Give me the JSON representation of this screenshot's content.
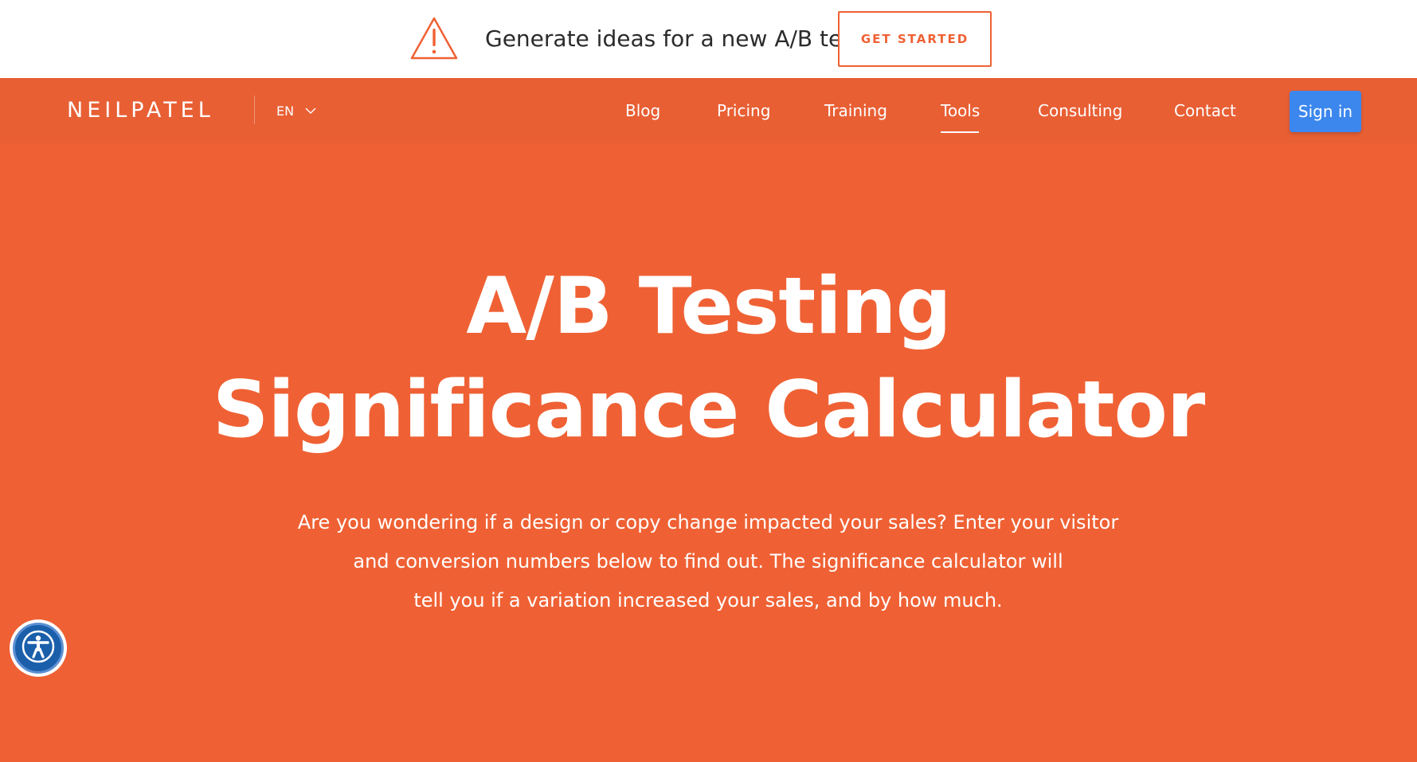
{
  "promo": {
    "text": "Generate ideas for a new A/B test",
    "button_label": "GET STARTED",
    "icon": "warning-triangle-icon",
    "accent_color": "#ef6134"
  },
  "nav": {
    "logo": "NEILPATEL",
    "language": "EN",
    "links": [
      {
        "label": "Blog"
      },
      {
        "label": "Pricing"
      },
      {
        "label": "Training"
      },
      {
        "label": "Tools",
        "active": true
      },
      {
        "label": "Consulting"
      },
      {
        "label": "Contact"
      }
    ],
    "signin_label": "Sign in",
    "signin_color": "#3c87ee"
  },
  "hero": {
    "background_color": "#ef6134",
    "title_lines": [
      "A/B Testing",
      "Significance Calculator"
    ],
    "subtitle_lines": [
      "Are you wondering if a design or copy change impacted your sales? Enter your visitor",
      "and conversion numbers below to find out. The significance calculator will",
      "tell you if a variation increased your sales, and by how much."
    ]
  },
  "accessibility": {
    "icon": "accessibility-person-icon"
  }
}
